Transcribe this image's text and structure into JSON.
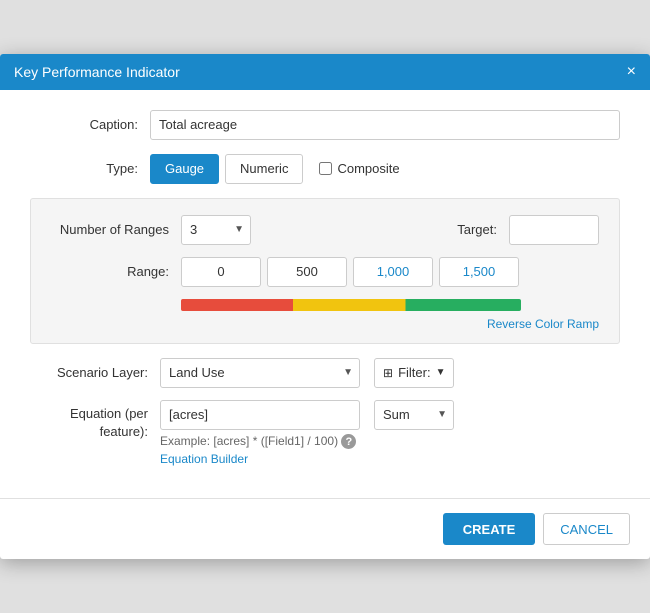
{
  "dialog": {
    "title": "Key Performance Indicator",
    "close_label": "×"
  },
  "caption": {
    "label": "Caption:",
    "value": "Total acreage"
  },
  "type": {
    "label": "Type:",
    "gauge_label": "Gauge",
    "numeric_label": "Numeric",
    "composite_label": "Composite"
  },
  "ranges": {
    "number_label": "Number of Ranges",
    "number_value": "3",
    "target_label": "Target:",
    "range_label": "Range:",
    "range_0": "0",
    "range_1": "500",
    "range_2": "1,000",
    "range_3": "1,500",
    "reverse_label": "Reverse Color Ramp"
  },
  "scenario": {
    "label": "Scenario Layer:",
    "value": "Land Use",
    "filter_label": "Filter:"
  },
  "equation": {
    "label": "Equation (per feature):",
    "value": "[acres]",
    "example_text": "Example: [acres] * ([Field1] / 100)",
    "builder_label": "Equation Builder",
    "sum_label": "Sum"
  },
  "footer": {
    "create_label": "CREATE",
    "cancel_label": "CANCEL"
  }
}
